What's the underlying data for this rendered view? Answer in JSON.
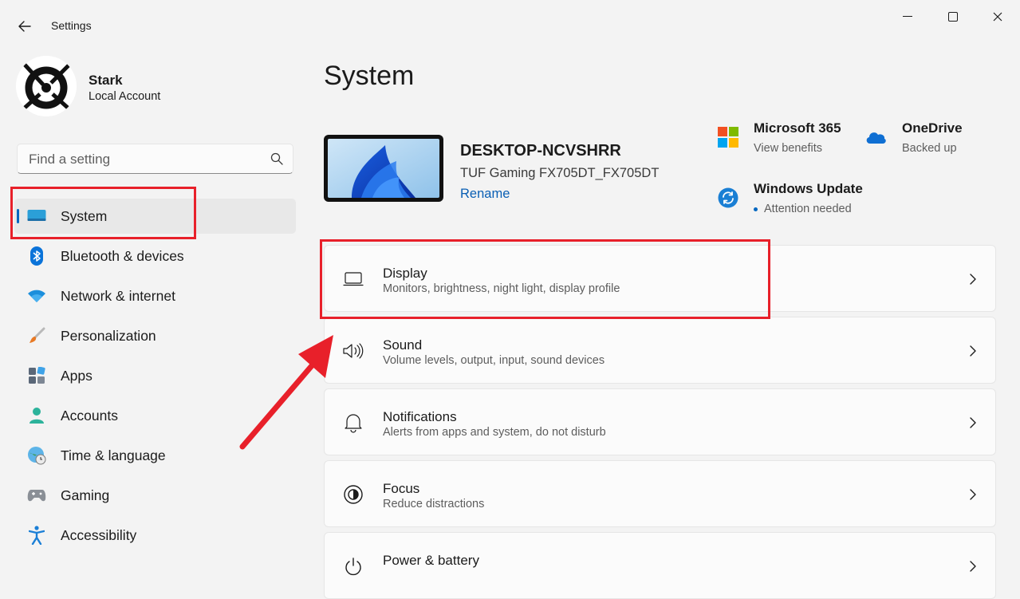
{
  "titlebar": {
    "app_title": "Settings",
    "back_icon": "arrow-left-icon",
    "minimize_icon": "minimize-icon",
    "maximize_icon": "maximize-icon",
    "close_icon": "close-icon"
  },
  "profile": {
    "name": "Stark",
    "account_type": "Local Account"
  },
  "search": {
    "placeholder": "Find a setting",
    "value": ""
  },
  "sidebar": {
    "items": [
      {
        "label": "System",
        "icon": "monitor-icon",
        "active": true
      },
      {
        "label": "Bluetooth & devices",
        "icon": "bluetooth-icon"
      },
      {
        "label": "Network & internet",
        "icon": "wifi-icon"
      },
      {
        "label": "Personalization",
        "icon": "brush-icon"
      },
      {
        "label": "Apps",
        "icon": "apps-icon"
      },
      {
        "label": "Accounts",
        "icon": "person-icon"
      },
      {
        "label": "Time & language",
        "icon": "globe-clock-icon"
      },
      {
        "label": "Gaming",
        "icon": "gamepad-icon"
      },
      {
        "label": "Accessibility",
        "icon": "accessibility-icon"
      }
    ]
  },
  "main": {
    "title": "System",
    "device": {
      "name": "DESKTOP-NCVSHRR",
      "model": "TUF Gaming FX705DT_FX705DT",
      "rename": "Rename"
    },
    "quick_links": [
      {
        "title": "Microsoft 365",
        "subtitle": "View benefits",
        "icon": "microsoft-logo-icon"
      },
      {
        "title": "OneDrive",
        "subtitle": "Backed up",
        "icon": "cloud-icon"
      },
      {
        "title": "Windows Update",
        "subtitle": "Attention needed",
        "icon": "sync-icon"
      }
    ],
    "cards": [
      {
        "title": "Display",
        "subtitle": "Monitors, brightness, night light, display profile",
        "icon": "laptop-icon"
      },
      {
        "title": "Sound",
        "subtitle": "Volume levels, output, input, sound devices",
        "icon": "speaker-icon"
      },
      {
        "title": "Notifications",
        "subtitle": "Alerts from apps and system, do not disturb",
        "icon": "bell-icon"
      },
      {
        "title": "Focus",
        "subtitle": "Reduce distractions",
        "icon": "focus-icon"
      },
      {
        "title": "Power & battery",
        "subtitle": "",
        "icon": "power-icon"
      }
    ]
  },
  "colors": {
    "accent": "#0067c0",
    "annotation": "#e8202a",
    "background": "#f3f3f3"
  }
}
